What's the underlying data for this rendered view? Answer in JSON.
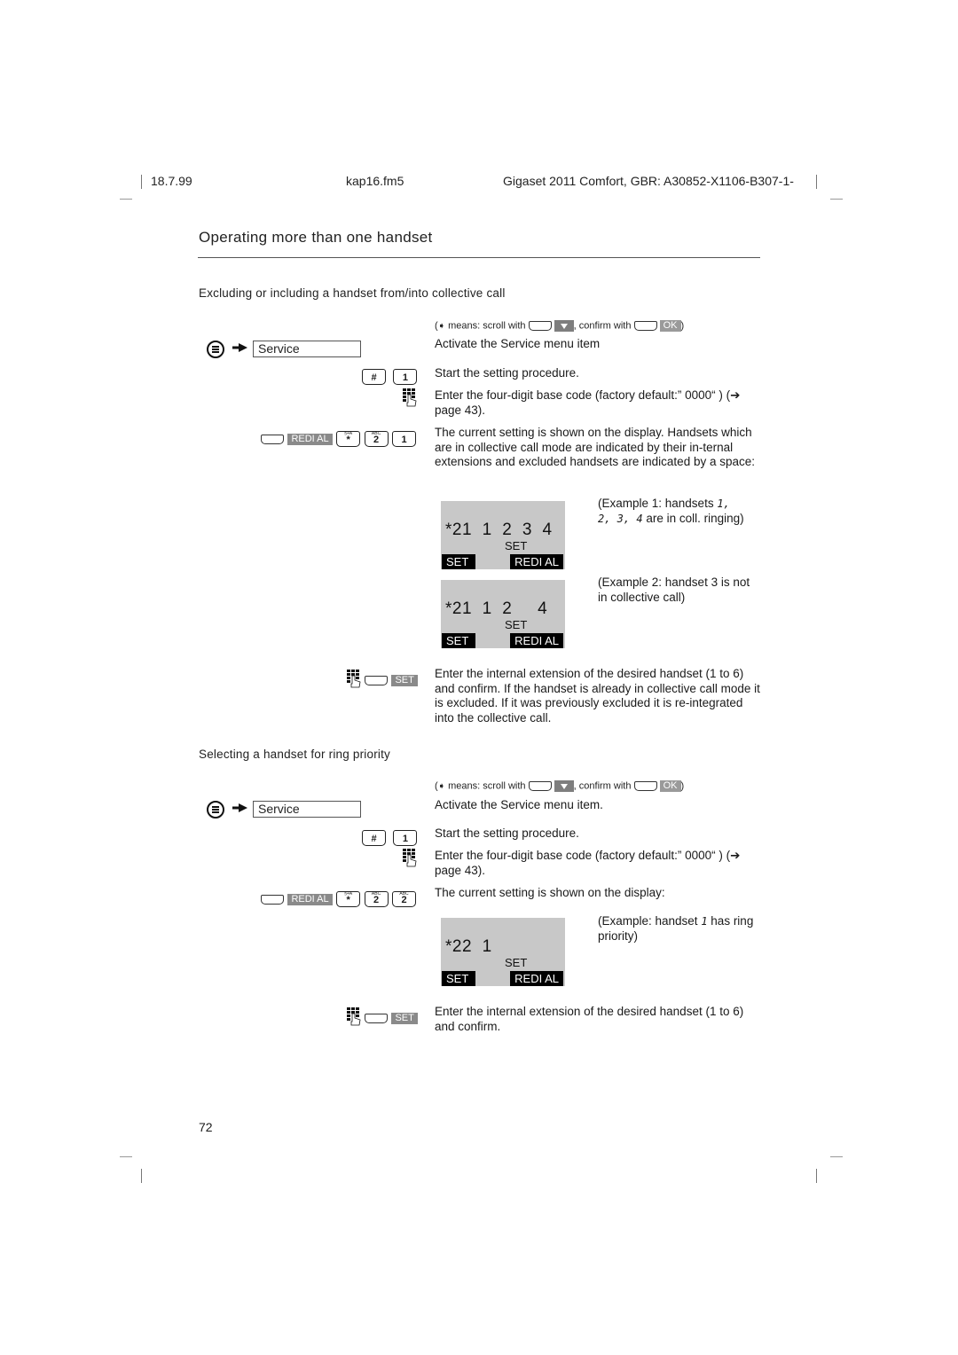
{
  "header": {
    "date": "18.7.99",
    "file": "kap16.fm5",
    "product": "Gigaset 2011 Comfort, GBR: A30852-X1106-B307-1-"
  },
  "page_title": "Operating more than one handset",
  "sections": [
    {
      "heading": "Excluding or including a handset from/into collective call",
      "legend": {
        "open": "(",
        "means": "means: scroll with",
        "confirm": ", confirm with",
        "ok_key": "OK",
        "close": ")"
      },
      "menu_item": "Service",
      "keys": {
        "hash": "#",
        "one": "1",
        "redial": "REDI AL",
        "star": "*",
        "star_sup": "§+A",
        "two": "2",
        "two_sup": "ABC",
        "last": "1",
        "set": "SET"
      },
      "steps": [
        "Activate the Service menu item",
        "Start the setting procedure.",
        "Enter the four-digit base code (factory default:” 0000“ ) (➔ page 43).",
        "The current setting is shown on the display. Handsets which are in collective call mode are indicated by their in-ternal extensions and excluded handsets are indicated by a space:",
        "Enter the internal extension of the desired handset (1 to 6) and confirm. If the handset is already in collective call mode it is excluded. If it was previously excluded it is re-integrated into the collective call."
      ],
      "displays": [
        {
          "digits": "*21  1  2  3  4",
          "middle": "SET",
          "left_softkey": "SET",
          "right_softkey": "REDI AL",
          "caption_a": "(Example 1:  handsets ",
          "caption_seg1": "1,",
          "caption_seg2": "2, 3, 4",
          "caption_b": " are in coll. ringing)"
        },
        {
          "digits": "*21  1  2     4",
          "middle": "SET",
          "left_softkey": "SET",
          "right_softkey": "REDI AL",
          "caption": "(Example 2:  handset 3 is not in collective call)"
        }
      ]
    },
    {
      "heading": "Selecting a handset for ring priority",
      "legend": {
        "open": "(",
        "means": "means: scroll with",
        "confirm": ", confirm with",
        "ok_key": "OK",
        "close": ")"
      },
      "menu_item": "Service",
      "keys": {
        "hash": "#",
        "one": "1",
        "redial": "REDI AL",
        "star": "*",
        "star_sup": "§+A",
        "two": "2",
        "two_sup": "ABC",
        "last": "2",
        "last_sup": "ABC",
        "set": "SET"
      },
      "steps": [
        "Activate the Service menu item.",
        "Start the setting procedure.",
        "Enter the four-digit base code (factory default:” 0000“ ) (➔ page 43).",
        "The current setting is shown on the display:",
        "Enter the internal extension of the desired handset (1 to 6) and confirm."
      ],
      "displays": [
        {
          "digits": "*22  1",
          "middle": "SET",
          "left_softkey": "SET",
          "right_softkey": "REDI AL",
          "caption_a": "(Example: handset  ",
          "caption_seg1": "1",
          "caption_b": " has ring priority)"
        }
      ]
    }
  ],
  "page_number": "72"
}
